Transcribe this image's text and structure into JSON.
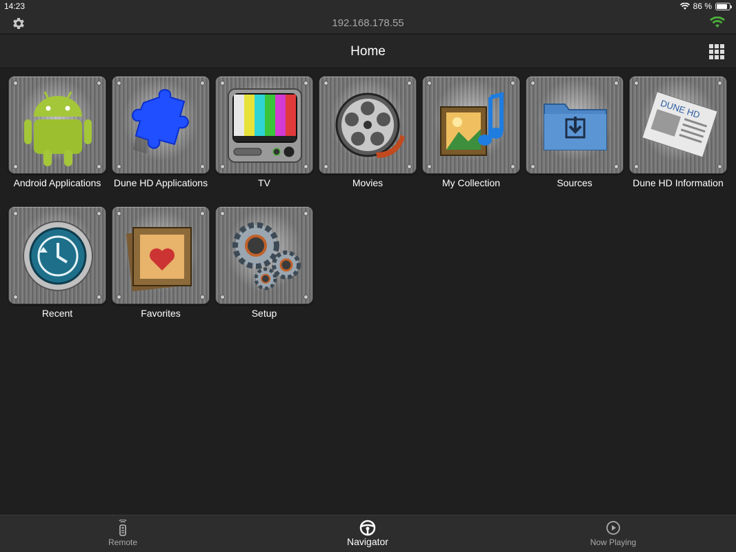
{
  "status_bar": {
    "time": "14:23",
    "battery_text": "86 %",
    "battery_level": 0.86
  },
  "connection": {
    "ip": "192.168.178.55"
  },
  "header": {
    "title": "Home"
  },
  "tiles": [
    {
      "label": "Android Applications",
      "icon": "android-icon"
    },
    {
      "label": "Dune HD Applications",
      "icon": "puzzle-icon"
    },
    {
      "label": "TV",
      "icon": "tv-icon"
    },
    {
      "label": "Movies",
      "icon": "film-reel-icon"
    },
    {
      "label": "My Collection",
      "icon": "media-collection-icon"
    },
    {
      "label": "Sources",
      "icon": "download-folder-icon"
    },
    {
      "label": "Dune HD Information",
      "icon": "newspaper-icon",
      "art_text": "DUNE HD"
    },
    {
      "label": "Recent",
      "icon": "clock-icon"
    },
    {
      "label": "Favorites",
      "icon": "heart-film-icon"
    },
    {
      "label": "Setup",
      "icon": "gears-icon"
    }
  ],
  "tab_bar": {
    "remote": "Remote",
    "navigator": "Navigator",
    "now_playing": "Now Playing",
    "active": "Navigator"
  },
  "colors": {
    "wifi_connected": "#4cae3b",
    "background": "#1f1f1f",
    "android_green": "#a4c639",
    "puzzle_blue": "#1f4fff"
  }
}
